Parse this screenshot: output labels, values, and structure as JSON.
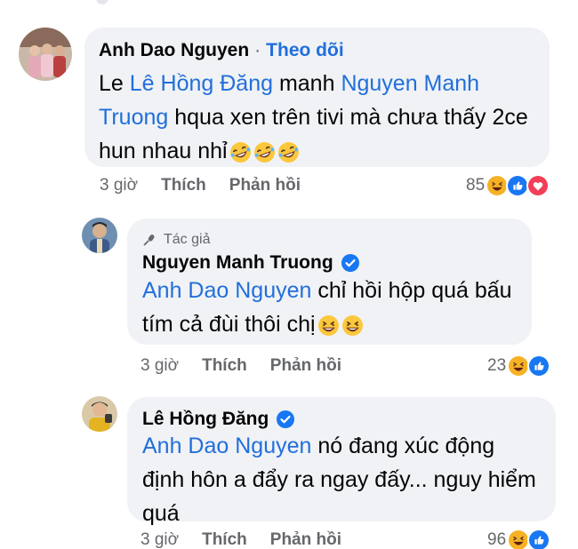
{
  "comments": [
    {
      "author": "Anh Dao Nguyen",
      "follow": "Theo dõi",
      "text_lines": [
        [
          "Le ",
          {
            "mention": "Lê Hồng Đăng"
          },
          " manh ",
          {
            "mention": "Nguyen Manh"
          }
        ],
        [
          {
            "mention": "Truong"
          },
          " hqua xen trên tivi mà chưa thấy 2ce"
        ],
        [
          "hun nhau nhỉ "
        ]
      ],
      "line1_plain": "Le ",
      "line1_mention1": "Lê Hồng Đăng",
      "line1_mid": " manh ",
      "line1_mention2": "Nguyen Manh",
      "line2_mention": "Truong",
      "line2_plain": " hqua xen trên tivi mà chưa thấy 2ce",
      "line3_plain": "hun nhau nhỉ",
      "emojis": [
        "rofl-emoji",
        "rofl-emoji",
        "rofl-emoji"
      ],
      "time": "3 giờ",
      "like": "Thích",
      "reply": "Phản hồi",
      "reaction_count": "85",
      "reactions": [
        "haha",
        "like",
        "love"
      ]
    },
    {
      "badge": "Tác giả",
      "author": "Nguyen Manh Truong",
      "line1_mention": "Anh Dao Nguyen",
      "line1_plain": " chỉ hồi hộp quá bấu",
      "line2_plain": "tím cả đùi thôi chị",
      "emojis": [
        "laugh-emoji",
        "laugh-emoji"
      ],
      "time": "3 giờ",
      "like": "Thích",
      "reply": "Phản hồi",
      "reaction_count": "23",
      "reactions": [
        "haha",
        "like"
      ]
    },
    {
      "author": "Lê Hồng Đăng",
      "line1_mention": "Anh Dao Nguyen",
      "line1_plain": " nó đang xúc động",
      "line2_plain": "định hôn a đẩy ra ngay đấy... nguy hiểm",
      "line3_plain": "quá",
      "time": "3 giờ",
      "like": "Thích",
      "reply": "Phản hồi",
      "reaction_count": "96",
      "reactions": [
        "haha",
        "like"
      ]
    }
  ],
  "colors": {
    "bubble": "#f0f2f5",
    "link": "#216fdb",
    "meta": "#65676b",
    "like": "#1877f2",
    "love": "#f33e58",
    "haha": "#f7b125"
  }
}
